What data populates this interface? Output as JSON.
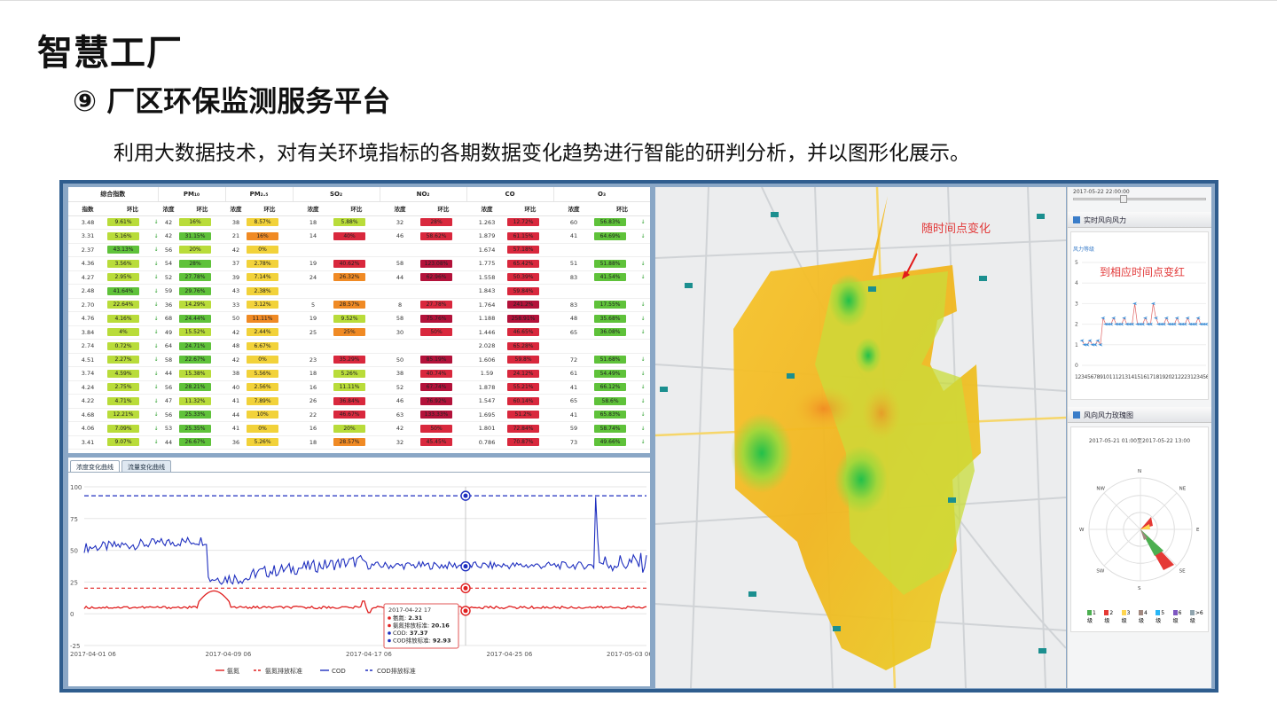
{
  "slide": {
    "title": "智慧工厂",
    "subtitle": "⑨ 厂区环保监测服务平台",
    "description": "利用大数据技术，对有关环境指标的各期数据变化趋势进行智能的研判分析，并以图形化展示。"
  },
  "table": {
    "groups": [
      "综合指数",
      "PM₁₀",
      "PM₂.₅",
      "SO₂",
      "NO₂",
      "CO",
      "O₃"
    ],
    "subheaders": [
      "指数",
      "环比",
      "浓度",
      "环比",
      "浓度",
      "环比",
      "浓度",
      "环比",
      "浓度",
      "环比",
      "浓度",
      "环比",
      "浓度",
      "环比"
    ],
    "rows": [
      [
        "3.48",
        "9.61%",
        "42",
        "16%",
        "38",
        "8.57%",
        "18",
        "5.88%",
        "32",
        "28%",
        "1.263",
        "12.72%",
        "60",
        "56.83%"
      ],
      [
        "3.31",
        "5.16%",
        "42",
        "31.15%",
        "21",
        "16%",
        "14",
        "40%",
        "46",
        "58.62%",
        "1.879",
        "61.15%",
        "41",
        "64.69%"
      ],
      [
        "2.37",
        "43.13%",
        "56",
        "20%",
        "42",
        "0%",
        "",
        "",
        "",
        "",
        "1.674",
        "57.18%",
        "",
        ""
      ],
      [
        "4.36",
        "3.56%",
        "54",
        "28%",
        "37",
        "2.78%",
        "19",
        "40.62%",
        "58",
        "123.08%",
        "1.775",
        "65.42%",
        "51",
        "51.88%"
      ],
      [
        "4.27",
        "2.95%",
        "52",
        "27.78%",
        "39",
        "7.14%",
        "24",
        "26.32%",
        "44",
        "62.96%",
        "1.558",
        "50.39%",
        "83",
        "41.54%"
      ],
      [
        "2.48",
        "41.64%",
        "59",
        "29.76%",
        "43",
        "2.38%",
        "",
        "",
        "",
        "",
        "1.843",
        "59.84%",
        "",
        ""
      ],
      [
        "2.70",
        "22.64%",
        "36",
        "14.29%",
        "33",
        "3.12%",
        "5",
        "28.57%",
        "8",
        "27.78%",
        "1.764",
        "241.2%",
        "83",
        "17.55%"
      ],
      [
        "4.76",
        "4.16%",
        "68",
        "24.44%",
        "50",
        "11.11%",
        "19",
        "9.52%",
        "58",
        "75.76%",
        "1.188",
        "258.91%",
        "48",
        "35.68%"
      ],
      [
        "3.84",
        "4%",
        "49",
        "15.52%",
        "42",
        "2.44%",
        "25",
        "25%",
        "30",
        "50%",
        "1.446",
        "46.65%",
        "65",
        "36.08%"
      ],
      [
        "2.74",
        "0.72%",
        "64",
        "24.71%",
        "48",
        "6.67%",
        "",
        "",
        "",
        "",
        "2.028",
        "65.28%",
        "",
        ""
      ],
      [
        "4.51",
        "2.27%",
        "58",
        "22.67%",
        "42",
        "0%",
        "23",
        "35.29%",
        "50",
        "85.19%",
        "1.606",
        "59.8%",
        "72",
        "51.68%"
      ],
      [
        "3.74",
        "4.59%",
        "44",
        "15.38%",
        "38",
        "5.56%",
        "18",
        "5.26%",
        "38",
        "40.74%",
        "1.59",
        "24.12%",
        "61",
        "54.49%"
      ],
      [
        "4.24",
        "2.75%",
        "56",
        "28.21%",
        "40",
        "2.56%",
        "16",
        "11.11%",
        "52",
        "67.74%",
        "1.878",
        "55.21%",
        "41",
        "66.12%"
      ],
      [
        "4.22",
        "4.71%",
        "47",
        "11.32%",
        "41",
        "7.89%",
        "26",
        "36.84%",
        "46",
        "76.92%",
        "1.547",
        "60.14%",
        "65",
        "58.6%"
      ],
      [
        "4.68",
        "12.21%",
        "56",
        "25.33%",
        "44",
        "10%",
        "22",
        "46.67%",
        "63",
        "133.33%",
        "1.695",
        "51.2%",
        "41",
        "65.83%"
      ],
      [
        "4.06",
        "7.09%",
        "53",
        "25.35%",
        "41",
        "0%",
        "16",
        "20%",
        "42",
        "50%",
        "1.801",
        "72.84%",
        "59",
        "58.74%"
      ],
      [
        "3.41",
        "9.07%",
        "44",
        "26.67%",
        "36",
        "5.26%",
        "18",
        "28.57%",
        "32",
        "45.45%",
        "0.786",
        "70.87%",
        "73",
        "49.66%"
      ]
    ],
    "colors": {
      "green": "#5fc23a",
      "lime": "#b9dc3a",
      "yellow": "#f2d23a",
      "orange": "#f08a24",
      "red": "#d9283d",
      "crimson": "#b3123a"
    }
  },
  "chart_tabs": [
    "浓度变化曲线",
    "流量变化曲线"
  ],
  "chart_data": {
    "type": "line",
    "ylim": [
      -25,
      100
    ],
    "yticks": [
      "100",
      "75",
      "50",
      "25",
      "0",
      "-25"
    ],
    "xticks": [
      "2017-04-01 06",
      "2017-04-09 06",
      "2017-04-17 06",
      "2017-04-25 06",
      "2017-05-03 06"
    ],
    "series": [
      {
        "name": "氨氮",
        "color": "#e02020",
        "style": "solid"
      },
      {
        "name": "氨氮排放标准",
        "color": "#e02020",
        "style": "dashed",
        "value": 20.16
      },
      {
        "name": "COD",
        "color": "#1f2fbf",
        "style": "solid"
      },
      {
        "name": "COD排放标准",
        "color": "#1f2fbf",
        "style": "dashed",
        "value": 92.93
      }
    ],
    "tooltip": {
      "time": "2017-04-22 17",
      "rows": [
        {
          "label": "氨氮",
          "value": "2.31",
          "color": "#e02020"
        },
        {
          "label": "氨氮排放标准",
          "value": "20.16",
          "color": "#e02020"
        },
        {
          "label": "COD",
          "value": "37.37",
          "color": "#1f2fbf"
        },
        {
          "label": "COD排放标准",
          "value": "92.93",
          "color": "#1f2fbf"
        }
      ]
    }
  },
  "map": {
    "annotation_1": "随时间点变化",
    "annotation_2": "到相应时间点变红"
  },
  "side": {
    "top_label": "2017-05-22 22:00:00",
    "wind_title": "实时风向风力",
    "wind_y_label": "风力等级",
    "wind_yticks": [
      "5",
      "4",
      "3",
      "2",
      "1",
      "0"
    ],
    "wind_xticks": "1234567891011121314151617181920212223123456789101112131415161718192021222",
    "rose_title": "风向风力玫瑰图",
    "rose_range": "2017-05-21 01:00至2017-05-22 13:00",
    "rose_dirs": [
      "N",
      "NE",
      "E",
      "SE",
      "S",
      "SW",
      "W",
      "NW"
    ],
    "rose_legend": [
      "1级",
      "2级",
      "3级",
      "4级",
      "5级",
      "6级",
      ">6级"
    ],
    "rose_colors": [
      "#4caf50",
      "#e53935",
      "#ffd54f",
      "#a1887f",
      "#29b6f6",
      "#7e57c2",
      "#90a4ae"
    ]
  }
}
